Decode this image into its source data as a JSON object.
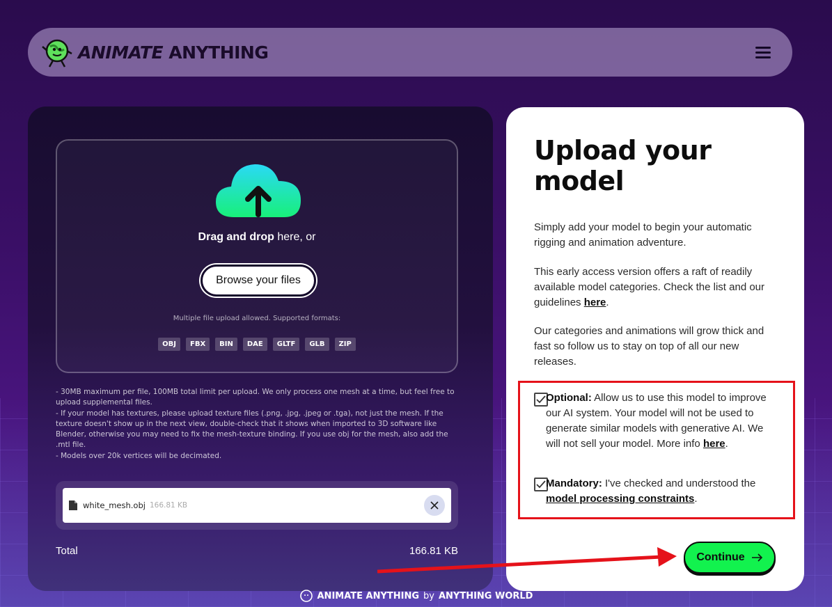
{
  "brand": {
    "logo_text_italic": "ANIMATE",
    "logo_text_plain": "ANYTHING"
  },
  "upload": {
    "drag_text_bold": "Drag and drop",
    "drag_text_rest": " here, or",
    "browse_label": "Browse your files",
    "formats_note": "Multiple file upload allowed. Supported formats:",
    "formats": [
      "OBJ",
      "FBX",
      "BIN",
      "DAE",
      "GLTF",
      "GLB",
      "ZIP"
    ]
  },
  "notes": [
    "- 30MB maximum per file, 100MB total limit per upload. We only process one mesh at a time, but feel free to upload supplemental files.",
    "- If your model has textures, please upload texture files (.png, .jpg, .jpeg or .tga), not just the mesh. If the texture doesn't show up in the next view, double-check that it shows when imported to 3D software like Blender, otherwise you may need to fix the mesh-texture binding. If you use obj for the mesh, also add the .mtl file.",
    "- Models over 20k vertices will be decimated."
  ],
  "file": {
    "name": "white_mesh.obj",
    "size": "166.81 KB"
  },
  "total": {
    "label": "Total",
    "value": "166.81 KB"
  },
  "panel": {
    "title": "Upload your model",
    "para1": "Simply add your model to begin your automatic rigging and animation adventure.",
    "para2_pre": "This early access version offers a raft of readily available model categories. Check the list and our guidelines ",
    "para2_link": "here",
    "para2_post": ".",
    "para3": "Our categories and animations will grow thick and fast so follow us to stay on top of all our new releases.",
    "optional_label": "Optional:",
    "optional_text": " Allow us to use this model to improve our AI system. Your model will not be used to generate similar models with generative AI. We will not sell your model. More info ",
    "optional_link": "here",
    "optional_post": ".",
    "mandatory_label": "Mandatory:",
    "mandatory_text": " I've checked and understood the ",
    "mandatory_link": "model processing constraints",
    "mandatory_post": ".",
    "continue_label": "Continue",
    "optional_checked": true,
    "mandatory_checked": true
  },
  "footer": {
    "brand": "ANIMATE ANYTHING",
    "by": "by",
    "company": "ANYTHING WORLD"
  },
  "colors": {
    "accent_green": "#12f24e",
    "highlight_red": "#e5121a",
    "cloud_top": "#2ad9f5",
    "cloud_bottom": "#18f07a"
  }
}
